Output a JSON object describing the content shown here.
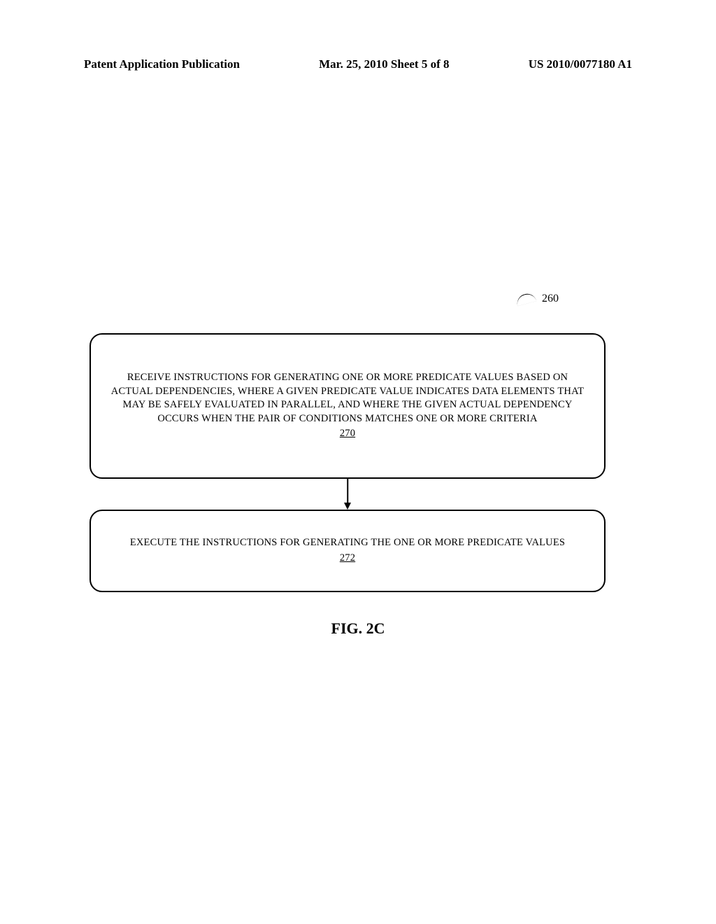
{
  "header": {
    "left": "Patent Application Publication",
    "center": "Mar. 25, 2010  Sheet 5 of 8",
    "right": "US 2010/0077180 A1"
  },
  "reference_number": "260",
  "flowchart": {
    "box1": {
      "text": "RECEIVE INSTRUCTIONS FOR GENERATING ONE OR MORE PREDICATE VALUES BASED ON ACTUAL DEPENDENCIES, WHERE A GIVEN PREDICATE VALUE INDICATES DATA ELEMENTS THAT MAY BE SAFELY EVALUATED IN PARALLEL, AND WHERE THE GIVEN ACTUAL DEPENDENCY OCCURS WHEN THE PAIR OF CONDITIONS  MATCHES ONE OR MORE CRITERIA",
      "ref": "270"
    },
    "box2": {
      "text": "EXECUTE THE INSTRUCTIONS FOR GENERATING THE ONE OR MORE PREDICATE VALUES",
      "ref": "272"
    }
  },
  "figure_label": "FIG. 2C"
}
